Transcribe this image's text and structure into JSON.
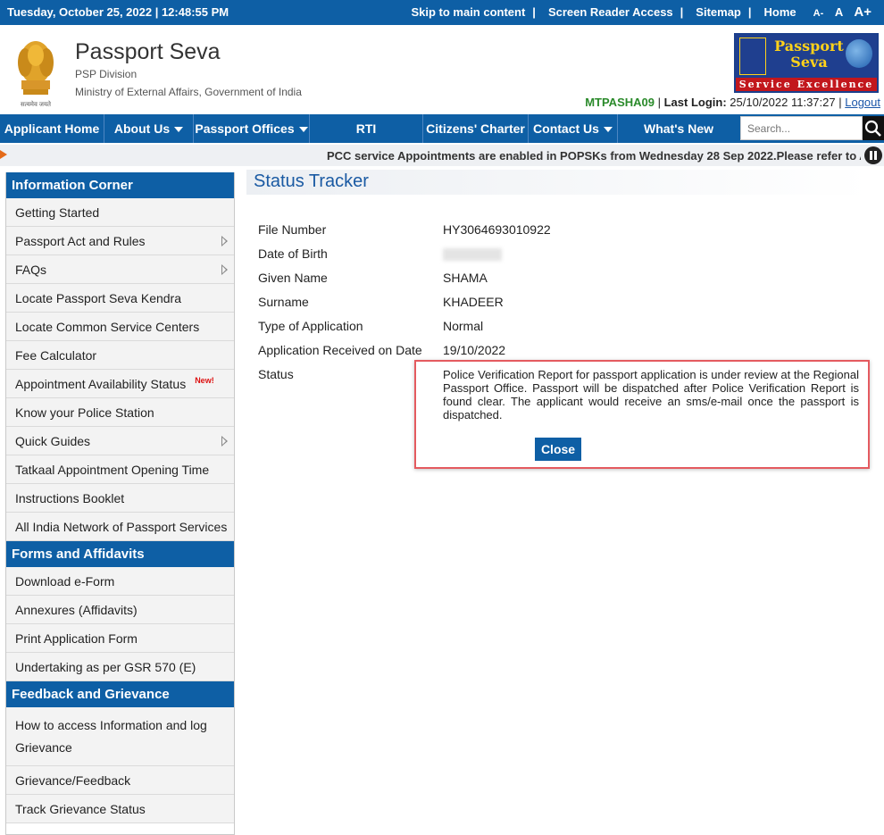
{
  "topbar": {
    "datetime": "Tuesday,  October  25, 2022 | 12:48:55 PM",
    "links": [
      "Skip to main content",
      "Screen Reader Access",
      "Sitemap",
      "Home"
    ],
    "font_sizes": [
      "A-",
      "A",
      "A+"
    ]
  },
  "header": {
    "emblem_caption": "सत्यमेव जयते",
    "title": "Passport Seva",
    "subtitle": "PSP Division",
    "ministry": "Ministry of External Affairs, Government of India",
    "logo_line1": "Passport",
    "logo_line2": "Seva",
    "logo_tagline": "Service Excellence"
  },
  "login": {
    "user_id": "MTPASHA09",
    "last_login_label": "Last Login:",
    "last_login_value": "25/10/2022 11:37:27",
    "logout": "Logout"
  },
  "nav": {
    "items": [
      "Applicant Home",
      "About Us",
      "Passport Offices",
      "RTI",
      "Citizens' Charter",
      "Contact Us",
      "What's New"
    ],
    "search_placeholder": "Search..."
  },
  "ticker": {
    "text": "PCC service Appointments are enabled in POPSKs from Wednesday 28 Sep 2022.Please refer to Appointment Availability Status"
  },
  "sidebar": {
    "sections": [
      {
        "title": "Information Corner",
        "items": [
          "Getting Started",
          "Passport Act and Rules",
          "FAQs",
          "Locate Passport Seva Kendra",
          "Locate Common Service Centers",
          "Fee Calculator",
          "Appointment Availability Status",
          "Know your Police Station",
          "Quick Guides",
          "Tatkaal Appointment Opening Time",
          "Instructions Booklet",
          "All India Network of Passport Services"
        ],
        "new_badge": "New!"
      },
      {
        "title": "Forms and Affidavits",
        "items": [
          "Download e-Form",
          "Annexures (Affidavits)",
          "Print Application Form",
          "Undertaking as per GSR 570 (E)"
        ]
      },
      {
        "title": "Feedback and Grievance",
        "items": [
          "How to access Information and log Grievance",
          "Grievance/Feedback",
          "Track Grievance Status"
        ]
      }
    ]
  },
  "status_tracker": {
    "title": "Status Tracker",
    "labels": [
      "File Number",
      "Date of Birth",
      "Given Name",
      "Surname",
      "Type of Application",
      "Application Received on Date",
      "Status"
    ],
    "values": {
      "file_number": "HY3064693010922",
      "given_name": "SHAMA",
      "surname": "KHADEER",
      "type_of_application": "Normal",
      "received_on": "19/10/2022"
    },
    "status_text": "Police Verification Report for passport application is under review at the Regional Passport Office. Passport will be dispatched after Police Verification Report is found clear. The applicant would receive an sms/e-mail once the passport is dispatched.",
    "close_label": "Close"
  }
}
